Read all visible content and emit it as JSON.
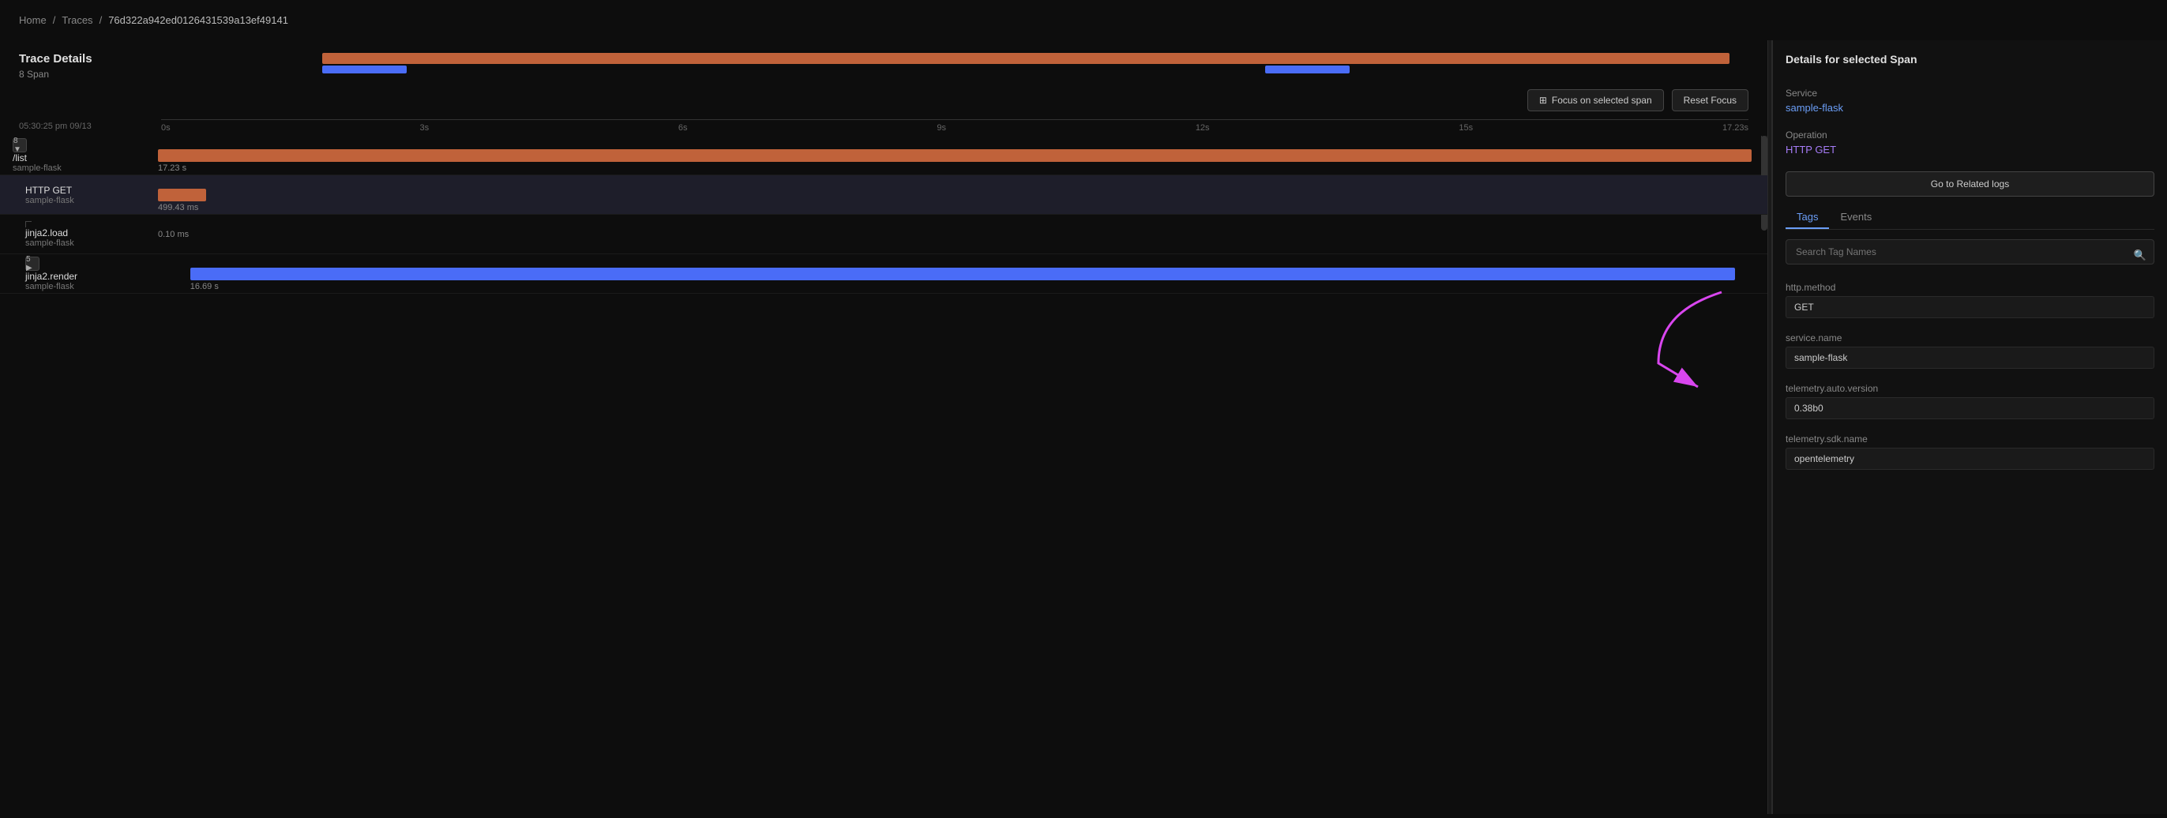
{
  "breadcrumb": {
    "home": "Home",
    "traces": "Traces",
    "separator": "/",
    "trace_id": "76d322a942ed0126431539a13ef49141"
  },
  "trace_details": {
    "title": "Trace Details",
    "span_count": "8 Span"
  },
  "timeline": {
    "date": "05:30:25 pm 09/13",
    "ticks": [
      "0s",
      "3s",
      "6s",
      "9s",
      "12s",
      "15s",
      "17.23s"
    ]
  },
  "controls": {
    "focus_span_label": "Focus on selected span",
    "reset_focus_label": "Reset Focus"
  },
  "spans": [
    {
      "id": "root",
      "toggle": "8",
      "toggle_direction": "▼",
      "name": "/list",
      "service": "sample-flask",
      "duration": "17.23 s",
      "bar_left_pct": 0,
      "bar_width_pct": 100,
      "bar_color": "#c0623a",
      "indent": 0
    },
    {
      "id": "http-get",
      "name": "HTTP GET",
      "service": "sample-flask",
      "duration": "499.43 ms",
      "bar_left_pct": 0,
      "bar_width_pct": 3,
      "bar_color": "#c0623a",
      "indent": 1,
      "selected": true
    },
    {
      "id": "jinja2-load",
      "name": "jinja2.load",
      "service": "sample-flask",
      "duration": "0.10 ms",
      "bar_left_pct": 0,
      "bar_width_pct": 0.01,
      "bar_color": "#c0623a",
      "indent": 1
    },
    {
      "id": "jinja2-render",
      "toggle": "5",
      "toggle_direction": "▶",
      "name": "jinja2.render",
      "service": "sample-flask",
      "duration": "16.69 s",
      "bar_left_pct": 2,
      "bar_width_pct": 96,
      "bar_color": "#4a6cf7",
      "indent": 1
    }
  ],
  "detail_panel": {
    "title": "Details for selected Span",
    "service_label": "Service",
    "service_value": "sample-flask",
    "operation_label": "Operation",
    "operation_value": "HTTP GET",
    "go_to_logs_btn": "Go to Related logs",
    "tabs": [
      "Tags",
      "Events"
    ],
    "active_tab": "Tags",
    "search_placeholder": "Search Tag Names",
    "tags": [
      {
        "label": "http.method",
        "value": "GET"
      },
      {
        "label": "service.name",
        "value": "sample-flask"
      },
      {
        "label": "telemetry.auto.version",
        "value": "0.38b0"
      },
      {
        "label": "telemetry.sdk.name",
        "value": "opentelemetry"
      }
    ]
  },
  "colors": {
    "orange_bar": "#c0623a",
    "blue_bar": "#4a6cf7",
    "link_blue": "#6b9ef7",
    "selected_row": "#1e1e2a"
  }
}
